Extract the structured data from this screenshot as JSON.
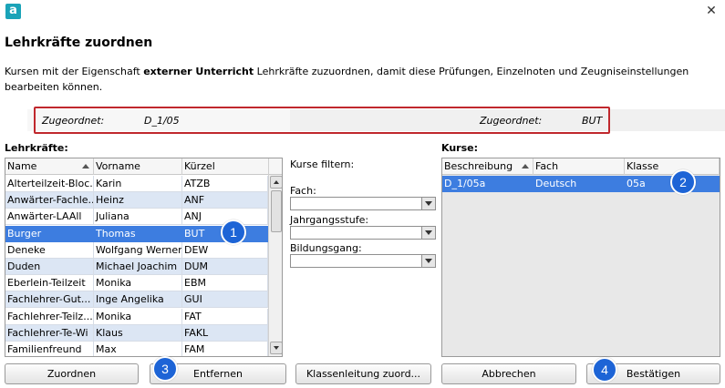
{
  "titlebar": {
    "logo_letter": "a",
    "close_glyph": "✕"
  },
  "dialog": {
    "title": "Lehrkräfte zuordnen",
    "description_before": "Kursen mit der Eigenschaft ",
    "description_bold": "externer Unterricht",
    "description_after": " Lehrkräfte zuzuordnen, damit diese Prüfungen, Einzelnoten und Zeugniseinstellungen bearbeiten können."
  },
  "assignment": {
    "left_label": "Zugeordnet:",
    "left_value": "D_1/05",
    "right_label": "Zugeordnet:",
    "right_value": "BUT",
    "frame_color": "#c0282d"
  },
  "teachers": {
    "section_label": "Lehrkräfte:",
    "columns": [
      "Name",
      "Vorname",
      "Kürzel"
    ],
    "sorted_column": "Name",
    "rows": [
      {
        "name": "Alterteilzeit-Bloc...",
        "vorname": "Karin",
        "kuerzel": "ATZB",
        "style": "norm"
      },
      {
        "name": "Anwärter-Fachle...",
        "vorname": "Heinz",
        "kuerzel": "ANF",
        "style": "alt"
      },
      {
        "name": "Anwärter-LAAll",
        "vorname": "Juliana",
        "kuerzel": "ANJ",
        "style": "norm"
      },
      {
        "name": "Burger",
        "vorname": "Thomas",
        "kuerzel": "BUT",
        "style": "sel"
      },
      {
        "name": "Deneke",
        "vorname": "Wolfgang Werner",
        "kuerzel": "DEW",
        "style": "norm"
      },
      {
        "name": "Duden",
        "vorname": "Michael Joachim",
        "kuerzel": "DUM",
        "style": "alt"
      },
      {
        "name": "Eberlein-Teilzeit",
        "vorname": "Monika",
        "kuerzel": "EBM",
        "style": "norm"
      },
      {
        "name": "Fachlehrer-Gut...",
        "vorname": "Inge Angelika",
        "kuerzel": "GUI",
        "style": "alt"
      },
      {
        "name": "Fachlehrer-Teilz...",
        "vorname": "Monika",
        "kuerzel": "FAT",
        "style": "norm"
      },
      {
        "name": "Fachlehrer-Te-Wi",
        "vorname": "Klaus",
        "kuerzel": "FAKL",
        "style": "alt"
      },
      {
        "name": "Familienfreund",
        "vorname": "Max",
        "kuerzel": "FAM",
        "style": "norm"
      }
    ]
  },
  "filters": {
    "heading": "Kurse filtern:",
    "fach_label": "Fach:",
    "fach_value": "",
    "jahrgang_label": "Jahrgangsstufe:",
    "jahrgang_value": "",
    "bildungsgang_label": "Bildungsgang:",
    "bildungsgang_value": ""
  },
  "courses": {
    "section_label": "Kurse:",
    "columns": [
      "Beschreibung",
      "Fach",
      "Klasse"
    ],
    "sorted_column": "Beschreibung",
    "rows": [
      {
        "beschreibung": "D_1/05a",
        "fach": "Deutsch",
        "klasse": "05a",
        "style": "sel"
      }
    ]
  },
  "buttons": {
    "zuordnen": "Zuordnen",
    "entfernen": "Entfernen",
    "klassenleitung": "Klassenleitung zuord...",
    "abbrechen": "Abbrechen",
    "bestaetigen": "Bestätigen"
  },
  "badges": {
    "b1": "1",
    "b2": "2",
    "b3": "3",
    "b4": "4",
    "color": "#1d64d6"
  },
  "colors": {
    "selection": "#3d7de0",
    "alt_row": "#dce6f4",
    "accent_logo": "#1aa3b8"
  }
}
